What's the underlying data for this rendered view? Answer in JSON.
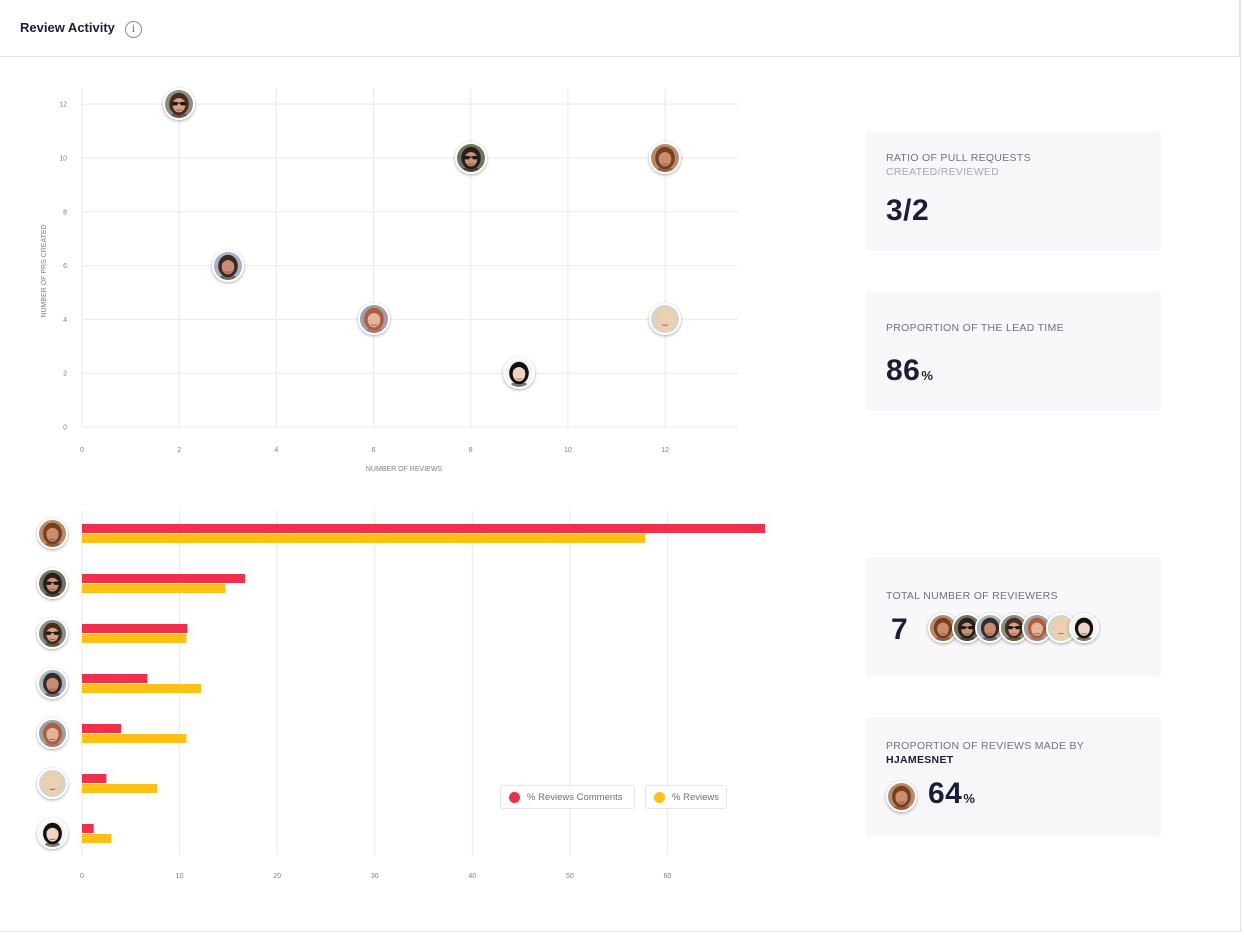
{
  "header": {
    "title": "Review Activity",
    "info_icon": "info-icon",
    "info_glyph": "i"
  },
  "scatter": {
    "x_axis_label": "NUMBER OF REVIEWS",
    "y_axis_label": "NUMBER OF PRS CREATED",
    "x_ticks": [
      "0",
      "2",
      "4",
      "6",
      "8",
      "10",
      "12"
    ],
    "y_ticks": [
      "0",
      "2",
      "4",
      "6",
      "8",
      "10",
      "12"
    ]
  },
  "bars": {
    "x_ticks": [
      "0",
      "10",
      "20",
      "30",
      "40",
      "50",
      "60"
    ],
    "legend": [
      {
        "label": "% Reviews Comments",
        "color": "#f0304a"
      },
      {
        "label": "% Reviews",
        "color": "#fcc016"
      }
    ]
  },
  "people": [
    {
      "id": "p1",
      "skin": "#c98e6c",
      "hair": "#7a3d20",
      "bg": "#b78a6a",
      "glasses": false
    },
    {
      "id": "p2",
      "skin": "#c99279",
      "hair": "#2b1d18",
      "bg": "#6b7560",
      "glasses": true
    },
    {
      "id": "p3",
      "skin": "#d7a184",
      "hair": "#4b2c1c",
      "bg": "#8a8f82",
      "glasses": true
    },
    {
      "id": "p4",
      "skin": "#c48c72",
      "hair": "#3a2a24",
      "bg": "#a7b2c4",
      "glasses": false
    },
    {
      "id": "p5",
      "skin": "#e0b59c",
      "hair": "#b35a3a",
      "bg": "#9aa0a6",
      "glasses": false
    },
    {
      "id": "p6",
      "skin": "#f0cdb6",
      "hair": "#e8d3a8",
      "bg": "#d8d2cc",
      "glasses": false
    },
    {
      "id": "p7",
      "skin": "#f1d3c2",
      "hair": "#111111",
      "bg": "#f4f4f4",
      "glasses": false
    }
  ],
  "chart_data": [
    {
      "type": "scatter",
      "title": "",
      "xlabel": "NUMBER OF REVIEWS",
      "ylabel": "NUMBER OF PRS CREATED",
      "xlim": [
        0,
        13.5
      ],
      "ylim": [
        0,
        12.6
      ],
      "grid": true,
      "points": [
        {
          "person": "p3",
          "x": 2,
          "y": 12
        },
        {
          "person": "p2",
          "x": 8,
          "y": 10
        },
        {
          "person": "p1",
          "x": 12,
          "y": 10
        },
        {
          "person": "p4",
          "x": 3,
          "y": 6
        },
        {
          "person": "p5",
          "x": 6,
          "y": 4
        },
        {
          "person": "p6",
          "x": 12,
          "y": 4
        },
        {
          "person": "p7",
          "x": 9,
          "y": 2
        }
      ]
    },
    {
      "type": "bar",
      "orientation": "horizontal",
      "categories": [
        "p1",
        "p2",
        "p3",
        "p4",
        "p5",
        "p6",
        "p7"
      ],
      "xlim": [
        0,
        70
      ],
      "grid": true,
      "legend_position": "bottom-right",
      "series": [
        {
          "name": "% Reviews Comments",
          "color": "#f0304a",
          "values": [
            70,
            16.7,
            10.8,
            6.7,
            4,
            2.5,
            1.2
          ]
        },
        {
          "name": "% Reviews",
          "color": "#fcc016",
          "values": [
            57.7,
            14.7,
            10.7,
            12.2,
            10.7,
            7.7,
            3
          ]
        }
      ]
    }
  ],
  "cards": {
    "ratio": {
      "label_line1": "RATIO OF PULL REQUESTS",
      "label_line2": "CREATED/REVIEWED",
      "value": "3/2"
    },
    "lead": {
      "label": "PROPORTION OF THE LEAD TIME",
      "value": "86",
      "unit": "%"
    },
    "reviewers": {
      "label": "TOTAL NUMBER OF REVIEWERS",
      "value": "7",
      "avatars": [
        "p1",
        "p2",
        "p4",
        "p3",
        "p5",
        "p6",
        "p7"
      ]
    },
    "made_by": {
      "label_line1": "PROPORTION OF REVIEWS MADE BY",
      "label_line2": "HJAMESNET",
      "person": "p1",
      "value": "64",
      "unit": "%"
    }
  }
}
